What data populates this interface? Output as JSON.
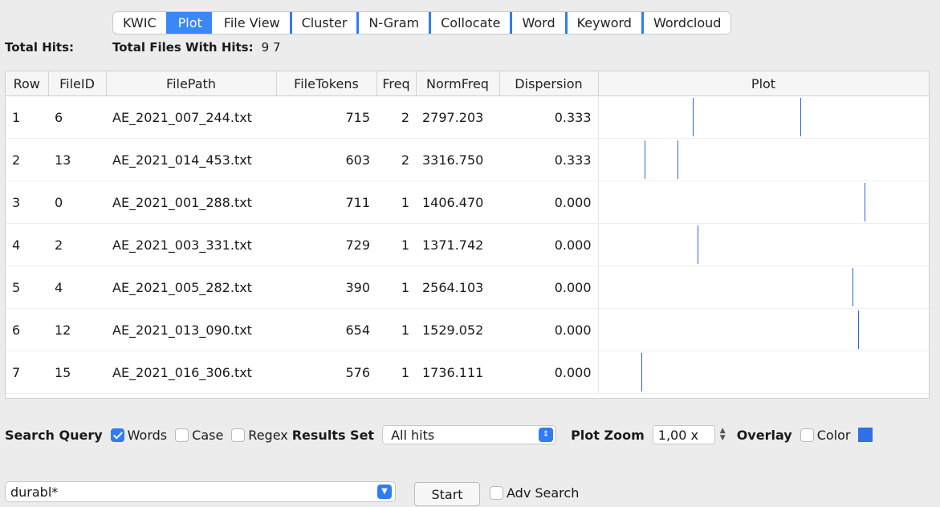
{
  "tabs": [
    "KWIC",
    "Plot",
    "File View",
    "Cluster",
    "N-Gram",
    "Collocate",
    "Word",
    "Keyword",
    "Wordcloud"
  ],
  "active_tab": "Plot",
  "totals": {
    "hits_label": "Total Hits:",
    "files_label": "Total Files With Hits:",
    "hits_value": "9",
    "files_value": "7"
  },
  "table": {
    "columns": [
      "Row",
      "FileID",
      "FilePath",
      "FileTokens",
      "Freq",
      "NormFreq",
      "Dispersion",
      "Plot"
    ],
    "rows": [
      {
        "row": "1",
        "fileid": "6",
        "path": "AE_2021_007_244.txt",
        "tokens": "715",
        "freq": "2",
        "norm": "2797.203",
        "disp": "0.333",
        "hits": [
          0.285,
          0.61
        ]
      },
      {
        "row": "2",
        "fileid": "13",
        "path": "AE_2021_014_453.txt",
        "tokens": "603",
        "freq": "2",
        "norm": "3316.750",
        "disp": "0.333",
        "hits": [
          0.14,
          0.24
        ]
      },
      {
        "row": "3",
        "fileid": "0",
        "path": "AE_2021_001_288.txt",
        "tokens": "711",
        "freq": "1",
        "norm": "1406.470",
        "disp": "0.000",
        "hits": [
          0.805
        ]
      },
      {
        "row": "4",
        "fileid": "2",
        "path": "AE_2021_003_331.txt",
        "tokens": "729",
        "freq": "1",
        "norm": "1371.742",
        "disp": "0.000",
        "hits": [
          0.3
        ]
      },
      {
        "row": "5",
        "fileid": "4",
        "path": "AE_2021_005_282.txt",
        "tokens": "390",
        "freq": "1",
        "norm": "2564.103",
        "disp": "0.000",
        "hits": [
          0.77
        ]
      },
      {
        "row": "6",
        "fileid": "12",
        "path": "AE_2021_013_090.txt",
        "tokens": "654",
        "freq": "1",
        "norm": "1529.052",
        "disp": "0.000",
        "hits": [
          0.785
        ]
      },
      {
        "row": "7",
        "fileid": "15",
        "path": "AE_2021_016_306.txt",
        "tokens": "576",
        "freq": "1",
        "norm": "1736.111",
        "disp": "0.000",
        "hits": [
          0.13
        ]
      }
    ]
  },
  "controls": {
    "search_query_label": "Search Query",
    "words_label": "Words",
    "words_checked": true,
    "case_label": "Case",
    "case_checked": false,
    "regex_label": "Regex",
    "regex_checked": false,
    "results_set_label": "Results Set",
    "results_set_value": "All hits",
    "plot_zoom_label": "Plot Zoom",
    "plot_zoom_value": "1,00 x",
    "overlay_label": "Overlay",
    "color_label": "Color",
    "color_checked": false,
    "color_swatch": "#2f6fe8"
  },
  "query": {
    "value": "durabl*",
    "start_label": "Start",
    "adv_label": "Adv Search",
    "adv_checked": false
  },
  "icons": {
    "select_arrow": "chevron-updown-icon",
    "dropdown_arrow": "chevron-down-icon"
  }
}
